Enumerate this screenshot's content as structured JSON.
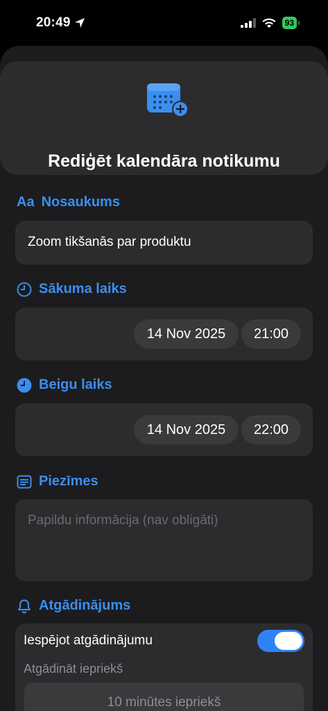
{
  "status_bar": {
    "time": "20:49",
    "battery": "93"
  },
  "header": {
    "title": "Rediģēt kalendāra notikumu",
    "icon": "calendar-add-icon"
  },
  "name_section": {
    "label": "Nosaukums",
    "icon_text": "Aa",
    "value": "Zoom tikšanās par produktu"
  },
  "start_section": {
    "label": "Sākuma laiks",
    "date": "14 Nov 2025",
    "time": "21:00"
  },
  "end_section": {
    "label": "Beigu laiks",
    "date": "14 Nov 2025",
    "time": "22:00"
  },
  "notes_section": {
    "label": "Piezīmes",
    "placeholder": "Papildu informācija (nav obligāti)"
  },
  "reminder_section": {
    "label": "Atgādinājums",
    "toggle_label": "Iespējot atgādinājumu",
    "toggle_on": true,
    "before_label": "Atgādināt iepriekš",
    "before_value": "10 minūtes iepriekš"
  },
  "colors": {
    "accent": "#3b8ef0",
    "toggle": "#2f82f5",
    "background": "#1c1c1e",
    "card": "#2c2c2e"
  }
}
